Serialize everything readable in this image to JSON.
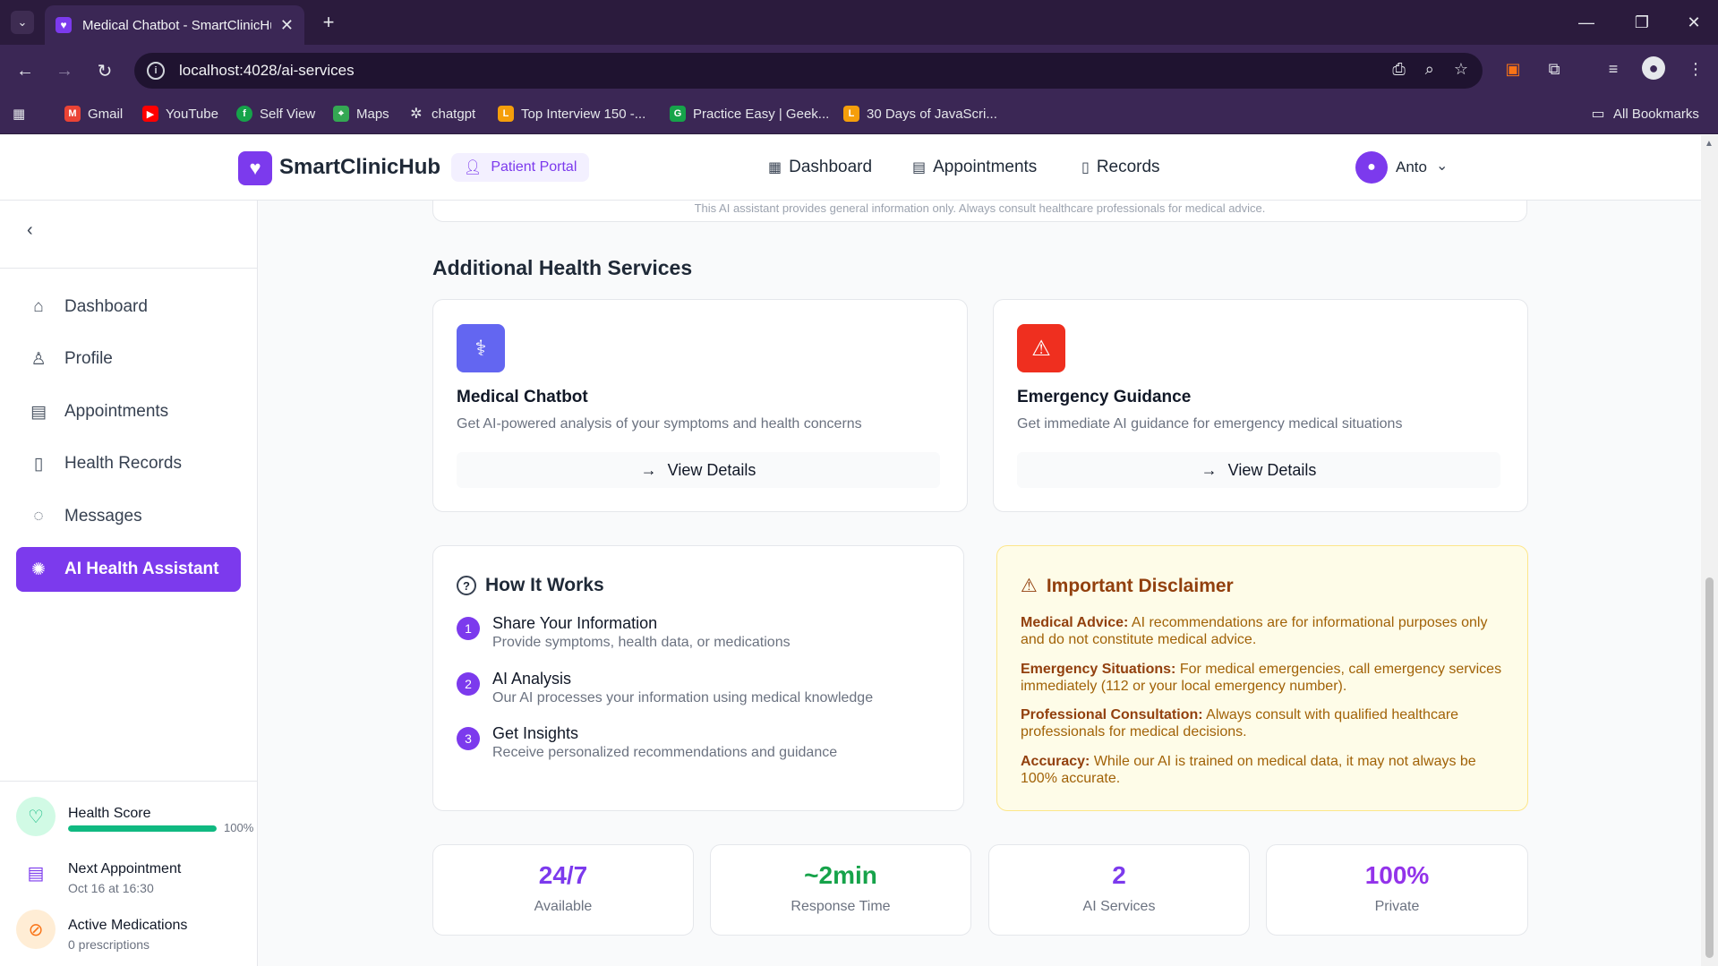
{
  "browser": {
    "tab_title": "Medical Chatbot - SmartClinicHub",
    "url": "localhost:4028/ai-services",
    "bookmarks": [
      "Gmail",
      "YouTube",
      "Self View",
      "Maps",
      "chatgpt",
      "Top Interview 150 -...",
      "Practice Easy | Geek...",
      "30 Days of JavaScri..."
    ],
    "all_bookmarks": "All Bookmarks"
  },
  "header": {
    "brand": "SmartClinicHub",
    "portal_badge": "Patient Portal",
    "nav": [
      "Dashboard",
      "Appointments",
      "Records"
    ],
    "user_name": "Anto"
  },
  "sidebar": {
    "items": [
      {
        "label": "Dashboard",
        "icon": "home-icon"
      },
      {
        "label": "Profile",
        "icon": "user-icon"
      },
      {
        "label": "Appointments",
        "icon": "calendar-icon"
      },
      {
        "label": "Health Records",
        "icon": "document-icon"
      },
      {
        "label": "Messages",
        "icon": "message-icon"
      },
      {
        "label": "AI Health Assistant",
        "icon": "brain-icon",
        "active": true
      }
    ],
    "stats": {
      "health_score": {
        "title": "Health Score",
        "value": "100%",
        "progress": 1.0
      },
      "next_appointment": {
        "title": "Next Appointment",
        "sub": "Oct 16 at 16:30"
      },
      "active_medications": {
        "title": "Active Medications",
        "sub": "0 prescriptions"
      }
    }
  },
  "main": {
    "prev_note": "This AI assistant provides general information only. Always consult healthcare professionals for medical advice.",
    "section_title": "Additional Health Services",
    "services": [
      {
        "title": "Medical Chatbot",
        "desc": "Get AI-powered analysis of your symptoms and health concerns",
        "button": "View Details",
        "icon": "stethoscope-icon",
        "color": "#6366f1"
      },
      {
        "title": "Emergency Guidance",
        "desc": "Get immediate AI guidance for emergency medical situations",
        "button": "View Details",
        "icon": "warning-icon",
        "color": "#ef2f1f"
      }
    ],
    "how_it_works": {
      "title": "How It Works",
      "steps": [
        {
          "num": "1",
          "title": "Share Your Information",
          "desc": "Provide symptoms, health data, or medications"
        },
        {
          "num": "2",
          "title": "AI Analysis",
          "desc": "Our AI processes your information using medical knowledge"
        },
        {
          "num": "3",
          "title": "Get Insights",
          "desc": "Receive personalized recommendations and guidance"
        }
      ]
    },
    "disclaimer": {
      "title": "Important Disclaimer",
      "items": [
        {
          "label": "Medical Advice:",
          "text": "AI recommendations are for informational purposes only and do not constitute medical advice."
        },
        {
          "label": "Emergency Situations:",
          "text": "For medical emergencies, call emergency services immediately (112 or your local emergency number)."
        },
        {
          "label": "Professional Consultation:",
          "text": "Always consult with qualified healthcare professionals for medical decisions."
        },
        {
          "label": "Accuracy:",
          "text": "While our AI is trained on medical data, it may not always be 100% accurate."
        }
      ]
    },
    "metrics": [
      {
        "value": "24/7",
        "label": "Available",
        "color": "#7c3aed"
      },
      {
        "value": "~2min",
        "label": "Response Time",
        "color": "#16a34a"
      },
      {
        "value": "2",
        "label": "AI Services",
        "color": "#7c3aed"
      },
      {
        "value": "100%",
        "label": "Private",
        "color": "#9333ea"
      }
    ]
  }
}
